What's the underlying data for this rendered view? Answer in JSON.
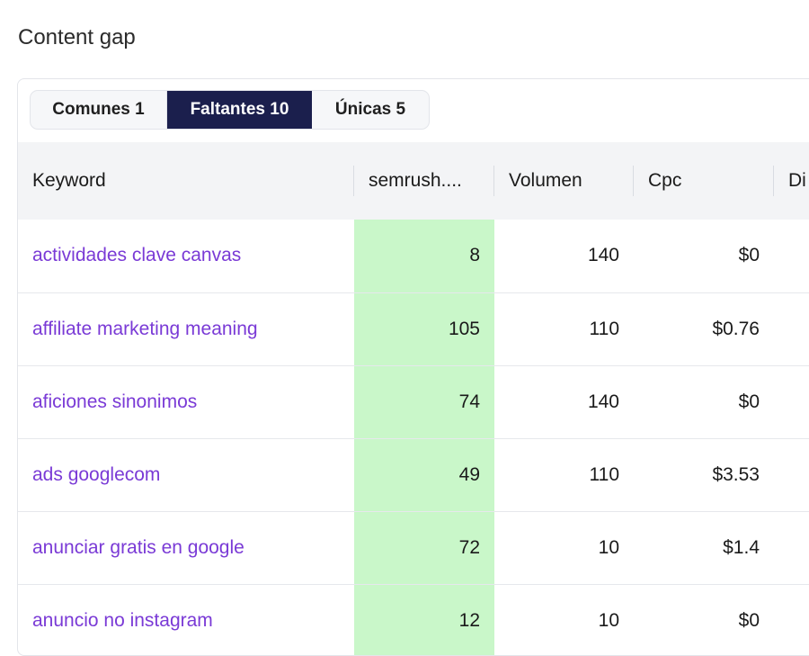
{
  "page": {
    "title": "Content gap"
  },
  "tabs": [
    {
      "label": "Comunes 1",
      "active": false
    },
    {
      "label": "Faltantes 10",
      "active": true
    },
    {
      "label": "Únicas 5",
      "active": false
    }
  ],
  "table": {
    "columns": [
      "Keyword",
      "semrush....",
      "Volumen",
      "Cpc",
      "Di"
    ],
    "rows": [
      {
        "keyword": "actividades clave canvas",
        "semrush": "8",
        "volumen": "140",
        "cpc": "$0"
      },
      {
        "keyword": "affiliate marketing meaning",
        "semrush": "105",
        "volumen": "110",
        "cpc": "$0.76"
      },
      {
        "keyword": "aficiones sinonimos",
        "semrush": "74",
        "volumen": "140",
        "cpc": "$0"
      },
      {
        "keyword": "ads googlecom",
        "semrush": "49",
        "volumen": "110",
        "cpc": "$3.53"
      },
      {
        "keyword": "anunciar gratis en google",
        "semrush": "72",
        "volumen": "10",
        "cpc": "$1.4"
      },
      {
        "keyword": "anuncio no instagram",
        "semrush": "12",
        "volumen": "10",
        "cpc": "$0"
      }
    ]
  },
  "colors": {
    "active_tab_bg": "#1b1f4d",
    "keyword_link": "#7a3ad6",
    "highlight_column": "#c9f7c9"
  }
}
